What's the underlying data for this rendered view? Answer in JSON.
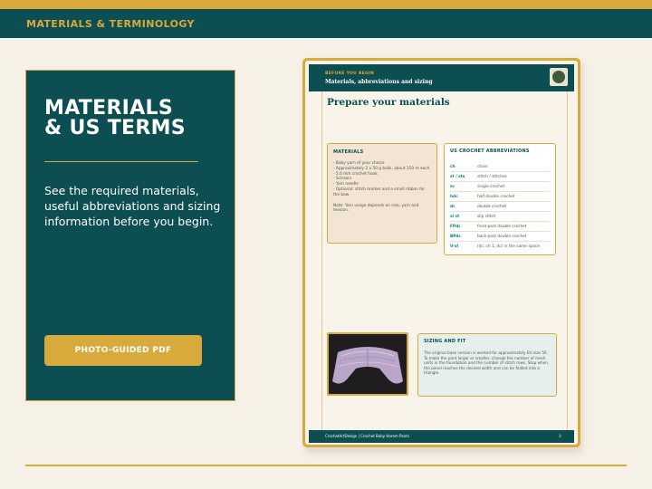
{
  "header": {
    "title": "MATERIALS & TERMINOLOGY"
  },
  "panel": {
    "title_line1": "MATERIALS",
    "title_line2": "& US TERMS",
    "description": "See the required materials, useful abbreviations and sizing information before you begin.",
    "cta_label": "PHOTO-GUIDED PDF"
  },
  "pdf_page": {
    "kicker": "BEFORE YOU BEGIN",
    "subtitle": "Materials, abbreviations and sizing",
    "title": "Prepare your materials",
    "materials": {
      "heading": "MATERIALS",
      "items": [
        "- Baby yarn of your choice",
        "- Approximately 2 x 50 g balls, about 150 m each",
        "- 5.0 mm crochet hook",
        "- Scissors",
        "- Yarn needle",
        "- Optional: stitch marker and a small ribbon for the bow"
      ],
      "note": "Note: Yarn usage depends on size, yarn and tension."
    },
    "abbreviations": {
      "heading": "US CROCHET ABBREVIATIONS",
      "rows": [
        {
          "abbr": "ch",
          "meaning": "chain"
        },
        {
          "abbr": "st / sts",
          "meaning": "stitch / stitches"
        },
        {
          "abbr": "sc",
          "meaning": "single crochet"
        },
        {
          "abbr": "hdc",
          "meaning": "half double crochet"
        },
        {
          "abbr": "dc",
          "meaning": "double crochet"
        },
        {
          "abbr": "sl st",
          "meaning": "slip stitch"
        },
        {
          "abbr": "FPdc",
          "meaning": "front-post double crochet"
        },
        {
          "abbr": "BPdc",
          "meaning": "back-post double crochet"
        },
        {
          "abbr": "V-st",
          "meaning": "(dc, ch 1, dc) in the same space"
        }
      ]
    },
    "sizing": {
      "heading": "SIZING AND FIT",
      "text": "The original base version is worked for approximately EU size 56. To make the pant larger or smaller, change the number of mesh units in the foundation and the number of stitch rows. Stop when the panel reaches the desired width and can be folded into a triangle."
    },
    "footer": {
      "text": "CrochetArtDesign  |  Crochet Baby Harem Pants",
      "page_number": "3"
    }
  },
  "colors": {
    "teal": "#0c4e52",
    "gold": "#d8a93b",
    "cream": "#f6f1e6"
  }
}
